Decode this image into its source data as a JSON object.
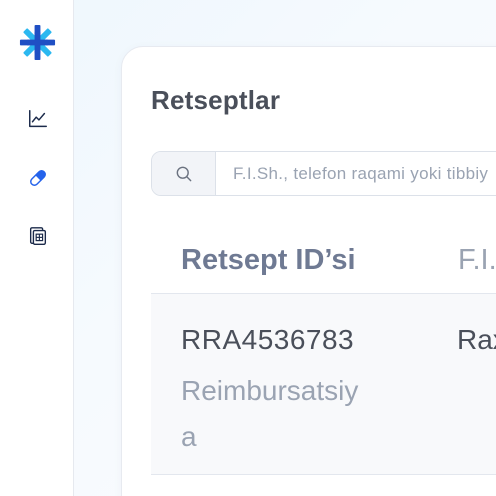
{
  "brand": {
    "color": "#1f4fc4",
    "accent": "#2bb8f0"
  },
  "sidebar": {
    "items": [
      {
        "icon": "chart-line-icon",
        "label": ""
      },
      {
        "icon": "pill-icon",
        "label": "",
        "active": true
      },
      {
        "icon": "documents-icon",
        "label": ""
      }
    ]
  },
  "page": {
    "title": "Retseptlar"
  },
  "search": {
    "placeholder": "F.I.Sh., telefon raqami yoki tibbiy"
  },
  "table": {
    "columns": [
      "Retsept ID’si",
      "F.I.Sh."
    ],
    "rows": [
      {
        "id": "RRA4536783",
        "type": "Reimbursatsiya",
        "name": "Rax"
      }
    ]
  }
}
